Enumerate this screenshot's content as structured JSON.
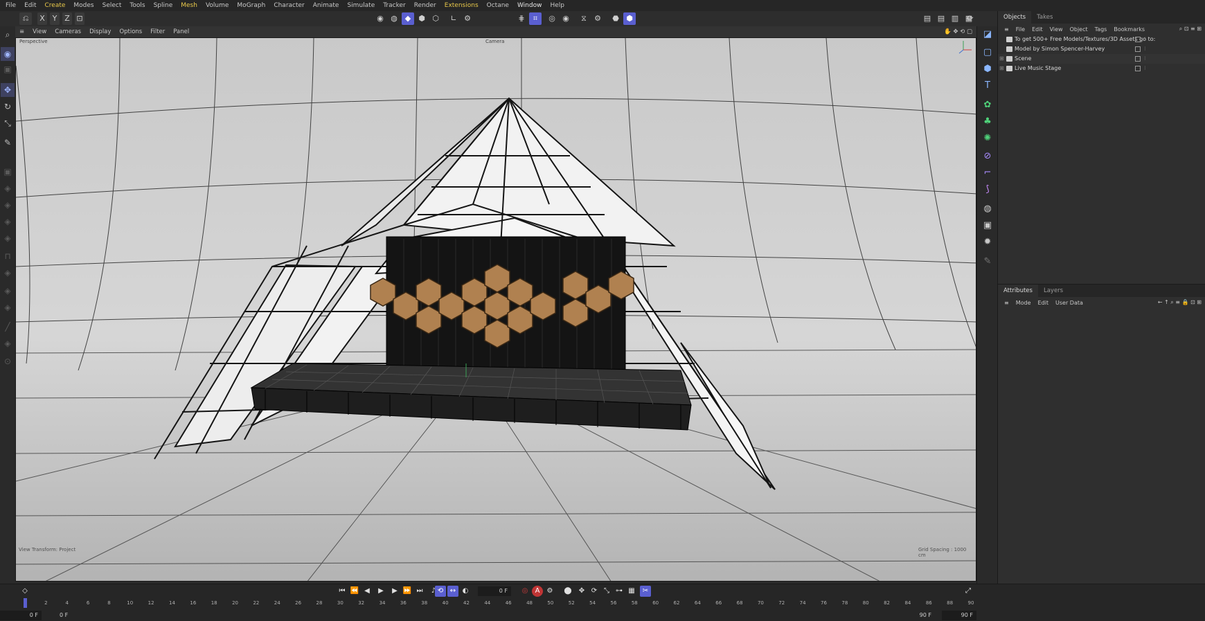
{
  "menu": {
    "items": [
      "File",
      "Edit",
      "Create",
      "Modes",
      "Select",
      "Tools",
      "Spline",
      "Mesh",
      "Volume",
      "MoGraph",
      "Character",
      "Animate",
      "Simulate",
      "Tracker",
      "Render",
      "Extensions",
      "Octane",
      "Window",
      "Help"
    ],
    "highlighted": [
      "Create",
      "Mesh",
      "Extensions"
    ]
  },
  "toolbar": {
    "axis_x": "X",
    "axis_y": "Y",
    "axis_z": "Z"
  },
  "viewport": {
    "menu": [
      "View",
      "Cameras",
      "Display",
      "Options",
      "Filter",
      "Panel"
    ],
    "name": "Perspective",
    "camera": "Camera",
    "transform_status": "View Transform: Project",
    "grid_spacing": "Grid Spacing : 1000 cm",
    "background_color": "#b9b9b9"
  },
  "objects_panel": {
    "tabs": [
      "Objects",
      "Takes"
    ],
    "menu": [
      "File",
      "Edit",
      "View",
      "Object",
      "Tags",
      "Bookmarks"
    ],
    "rows": [
      {
        "label": "To get 500+ Free Models/Textures/3D Assets go to:",
        "expandable": false
      },
      {
        "label": "Model by Simon Spencer-Harvey",
        "expandable": false
      },
      {
        "label": "Scene",
        "expandable": true
      },
      {
        "label": "Live Music Stage",
        "expandable": true
      }
    ]
  },
  "attributes_panel": {
    "tabs": [
      "Attributes",
      "Layers"
    ],
    "menu": [
      "Mode",
      "Edit",
      "User Data"
    ]
  },
  "timeline": {
    "current_frame": "0 F",
    "start_frame": "0 F",
    "start_frame_2": "0 F",
    "end_frame": "90 F",
    "end_frame_2": "90 F",
    "ticks": [
      "0",
      "2",
      "4",
      "6",
      "8",
      "10",
      "12",
      "14",
      "16",
      "18",
      "20",
      "22",
      "24",
      "26",
      "28",
      "30",
      "32",
      "34",
      "36",
      "38",
      "40",
      "42",
      "44",
      "46",
      "48",
      "50",
      "52",
      "54",
      "56",
      "58",
      "60",
      "62",
      "64",
      "66",
      "68",
      "70",
      "72",
      "74",
      "76",
      "78",
      "80",
      "82",
      "84",
      "86",
      "88",
      "90"
    ]
  },
  "colors": {
    "accent": "#5a5fd0",
    "menu_highlight": "#e8c84a",
    "record": "#d03a3a",
    "hex_panels": "#b08150"
  }
}
